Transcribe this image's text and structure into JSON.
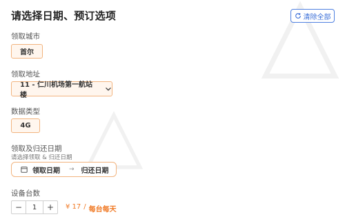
{
  "header": {
    "title": "请选择日期、预订选项",
    "clear_label": "清除全部",
    "accent_color": "#3b6fd8"
  },
  "city": {
    "label": "领取城市",
    "value": "首尔"
  },
  "address": {
    "label": "领取地址",
    "value": "11 - 仁川机场第一航站楼"
  },
  "data_type": {
    "label": "数据类型",
    "value": "4G"
  },
  "dates": {
    "label": "领取及归还日期",
    "hint": "请选择领取 & 归还日期",
    "pickup": "领取日期",
    "arrow": "→",
    "return": "归还日期"
  },
  "quantity": {
    "label": "设备台数",
    "minus": "−",
    "value": "1",
    "plus": "+",
    "price": "¥ 17",
    "separator": "/",
    "unit": "每台每天",
    "price_color": "#f07a26"
  },
  "icons": {
    "clear": "refresh-icon",
    "dropdown": "chevron-down-icon",
    "calendar": "calendar-icon"
  }
}
